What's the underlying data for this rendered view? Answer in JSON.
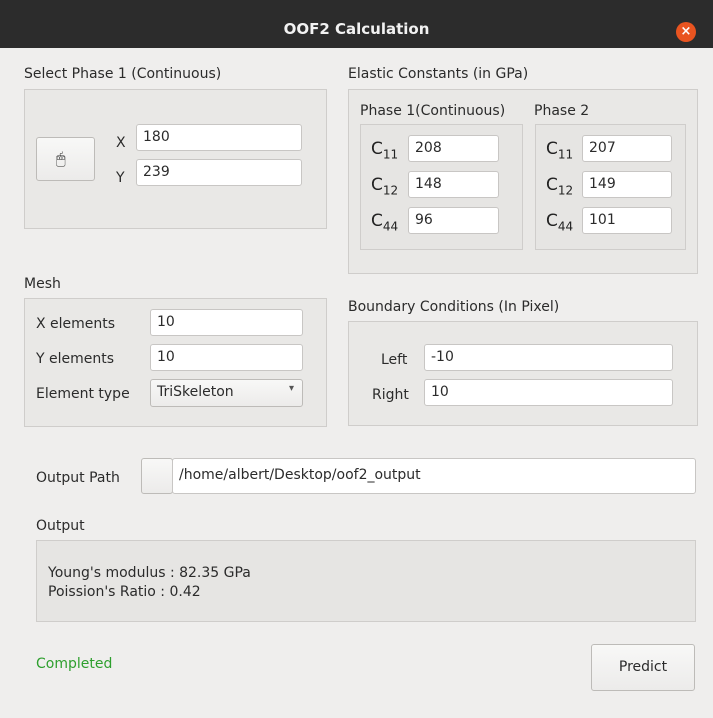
{
  "window": {
    "title": "OOF2 Calculation",
    "close_icon": "×"
  },
  "select_phase": {
    "title": "Select Phase 1 (Continuous)",
    "mouse_icon": "🖱",
    "x_label": "X",
    "x_value": "180",
    "y_label": "Y",
    "y_value": "239"
  },
  "elastic": {
    "title": "Elastic Constants (in GPa)",
    "phase1_title": "Phase 1(Continuous)",
    "phase2_title": "Phase 2",
    "c_letter": "C",
    "sub11": "11",
    "sub12": "12",
    "sub44": "44",
    "p1": {
      "c11": "208",
      "c12": "148",
      "c44": "96"
    },
    "p2": {
      "c11": "207",
      "c12": "149",
      "c44": "101"
    }
  },
  "mesh": {
    "title": "Mesh",
    "x_label": "X elements",
    "x_value": "10",
    "y_label": "Y elements",
    "y_value": "10",
    "type_label": "Element type",
    "type_value": "TriSkeleton",
    "chevron_icon": "▾"
  },
  "boundary": {
    "title": "Boundary Conditions  (In Pixel)",
    "left_label": "Left",
    "left_value": "-10",
    "right_label": "Right",
    "right_value": "10"
  },
  "output_path": {
    "label": "Output Path",
    "value": "/home/albert/Desktop/oof2_output"
  },
  "output": {
    "title": "Output",
    "line1": "Young's modulus : 82.35 GPa",
    "line2": "Poission's Ratio :  0.42"
  },
  "status": {
    "text": "Completed",
    "color": "#2e9f2e"
  },
  "predict_label": "Predict"
}
